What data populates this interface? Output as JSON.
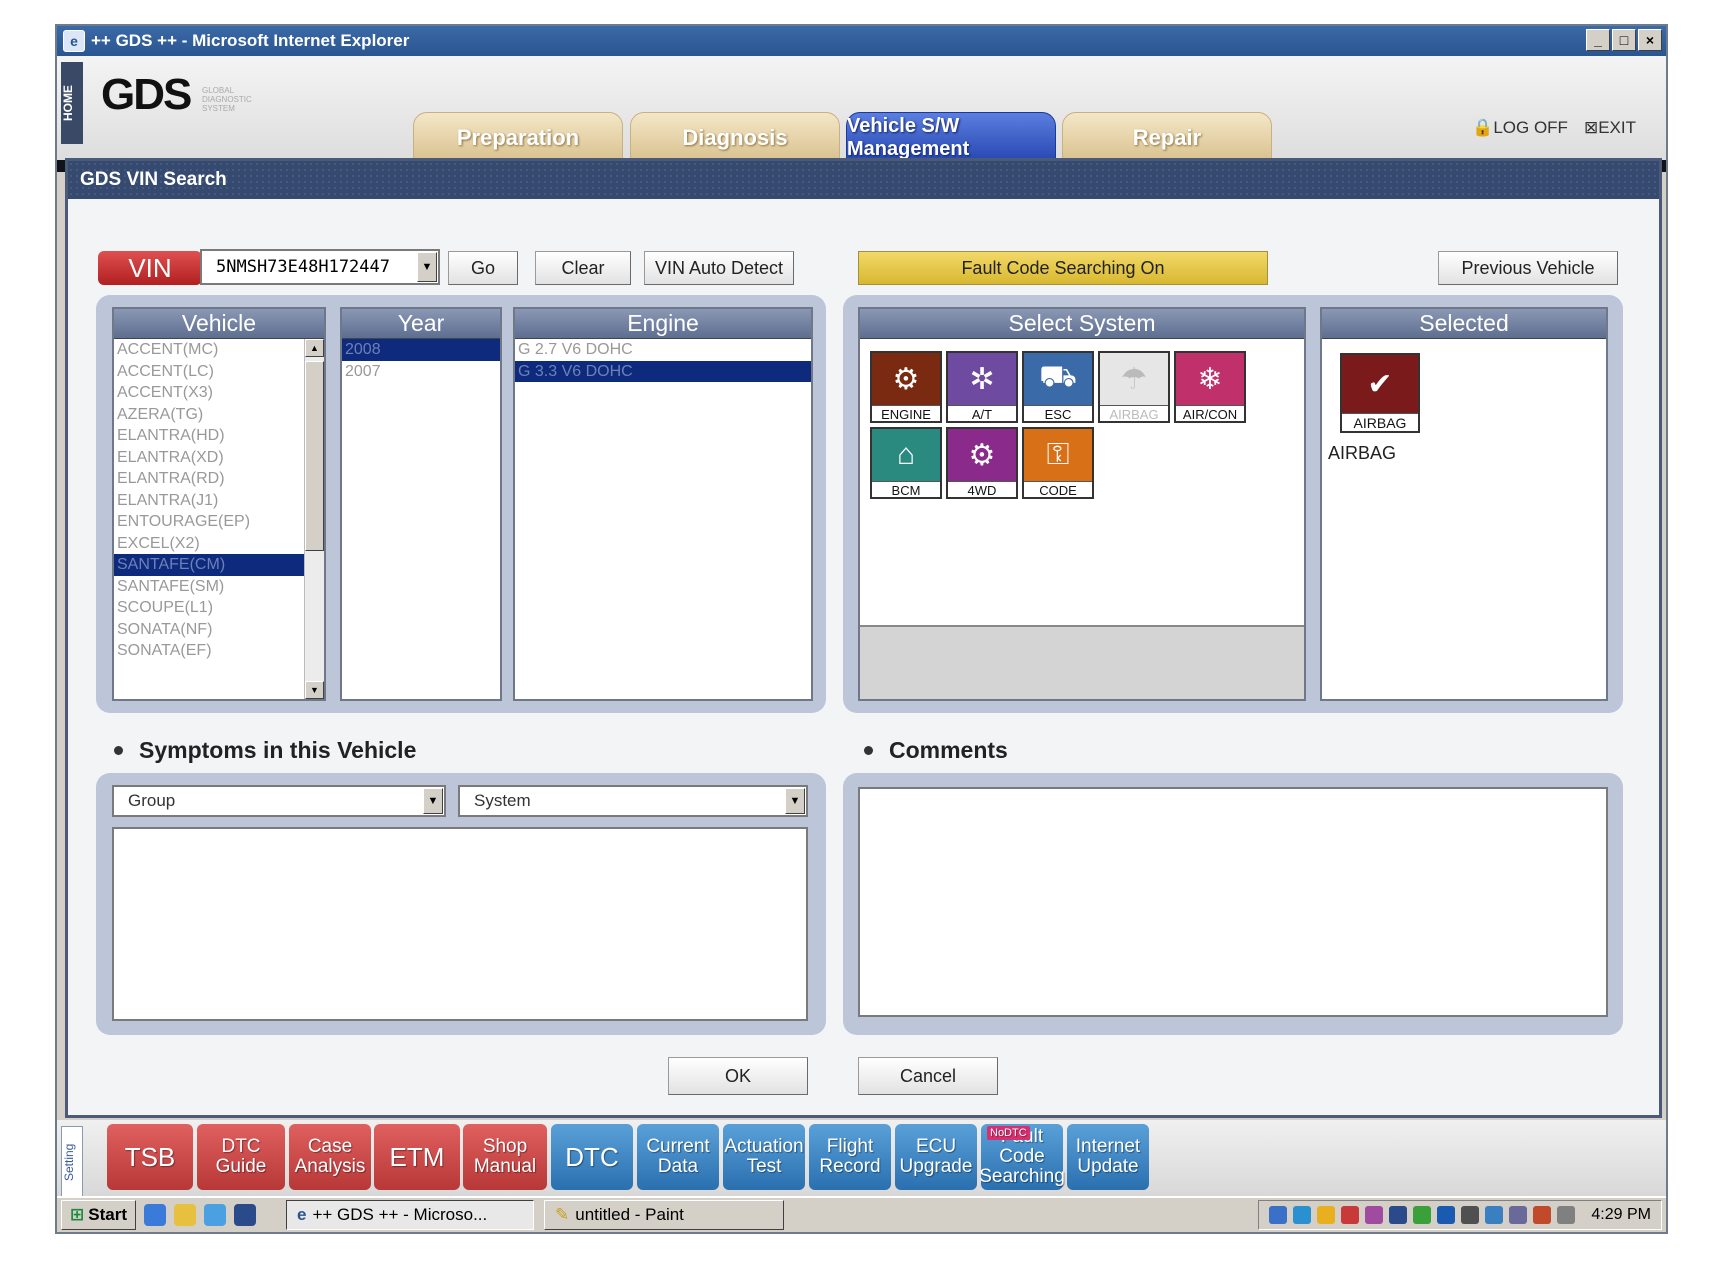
{
  "window": {
    "title": "++ GDS ++ - Microsoft Internet Explorer",
    "controls": [
      "_",
      "□",
      "×"
    ]
  },
  "header": {
    "home_label": "HOME",
    "logo": "GDS",
    "logo_sub": "GLOBAL DIAGNOSTIC SYSTEM",
    "tabs": [
      {
        "label": "Preparation"
      },
      {
        "label": "Diagnosis"
      },
      {
        "label": "Vehicle S/W Management"
      },
      {
        "label": "Repair"
      }
    ],
    "logoff_label": "LOG OFF",
    "exit_label": "EXIT"
  },
  "dialog": {
    "title": "GDS VIN Search",
    "vin_label": "VIN",
    "vin_value": "5NMSH73E48H172447",
    "go_label": "Go",
    "clear_label": "Clear",
    "vin_auto_detect_label": "VIN Auto Detect",
    "fault_code_label": "Fault Code Searching On",
    "previous_vehicle_label": "Previous Vehicle",
    "vehicle_header": "Vehicle",
    "vehicles": [
      "ACCENT(MC)",
      "ACCENT(LC)",
      "ACCENT(X3)",
      "AZERA(TG)",
      "ELANTRA(HD)",
      "ELANTRA(XD)",
      "ELANTRA(RD)",
      "ELANTRA(J1)",
      "ENTOURAGE(EP)",
      "EXCEL(X2)",
      "SANTAFE(CM)",
      "SANTAFE(SM)",
      "SCOUPE(L1)",
      "SONATA(NF)",
      "SONATA(EF)"
    ],
    "year_header": "Year",
    "years": [
      "2008",
      "2007"
    ],
    "engine_header": "Engine",
    "engines": [
      "G 2.7 V6 DOHC",
      "G 3.3 V6 DOHC"
    ],
    "select_system_header": "Select System",
    "systems": [
      {
        "label": "ENGINE",
        "color": "#7a2a10"
      },
      {
        "label": "A/T",
        "color": "#6e4aa0"
      },
      {
        "label": "ESC",
        "color": "#3a6aa8"
      },
      {
        "label": "AIRBAG",
        "color": "#e6e6e6"
      },
      {
        "label": "AIR/CON",
        "color": "#c0306a"
      },
      {
        "label": "BCM",
        "color": "#2a8a80"
      },
      {
        "label": "4WD",
        "color": "#8a2a8a"
      },
      {
        "label": "CODE",
        "color": "#d87018"
      }
    ],
    "selected_header": "Selected",
    "selected_tile_label": "AIRBAG",
    "selected_text": "AIRBAG",
    "symptoms_title": "Symptoms in this Vehicle",
    "group_placeholder": "Group",
    "system_placeholder": "System",
    "comments_title": "Comments",
    "ok_label": "OK",
    "cancel_label": "Cancel"
  },
  "toolbar": {
    "setting_label": "Setting",
    "buttons": [
      {
        "label": "TSB"
      },
      {
        "label": "DTC Guide"
      },
      {
        "label": "Case Analysis"
      },
      {
        "label": "ETM"
      },
      {
        "label": "Shop Manual"
      },
      {
        "label": "DTC"
      },
      {
        "label": "Current Data"
      },
      {
        "label": "Actuation Test"
      },
      {
        "label": "Flight Record"
      },
      {
        "label": "ECU Upgrade"
      },
      {
        "label": "Fault Code Searching"
      },
      {
        "label": "Internet Update"
      }
    ],
    "nodtc_badge": "NoDTC"
  },
  "taskbar": {
    "start_label": "Start",
    "items": [
      {
        "label": "++ GDS ++ - Microso..."
      },
      {
        "label": "untitled - Paint"
      }
    ],
    "clock": "4:29 PM"
  },
  "colors": {
    "tab_active": "#2446b0",
    "red_button": "#b83838",
    "blue_button": "#2a70b0",
    "selection": "#0d2a7c",
    "fault_bar": "#d8b830"
  }
}
